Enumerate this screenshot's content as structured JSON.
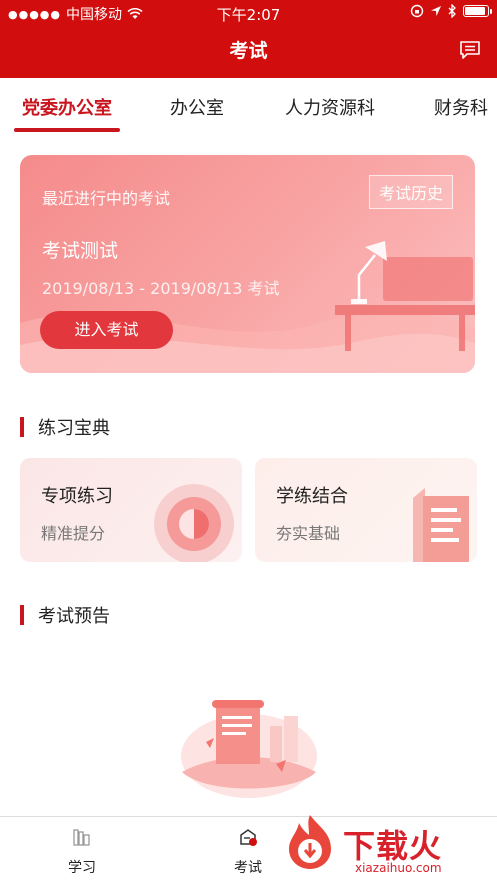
{
  "status_bar": {
    "carrier": "中国移动",
    "time": "下午2:07"
  },
  "nav": {
    "title": "考试",
    "icon": "message-icon"
  },
  "tabs": [
    {
      "label": "党委办公室",
      "active": true
    },
    {
      "label": "办公室",
      "active": false
    },
    {
      "label": "人力资源科",
      "active": false
    },
    {
      "label": "财务科",
      "active": false
    }
  ],
  "recent_exam": {
    "section_label": "最近进行中的考试",
    "history_button": "考试历史",
    "exam_name": "考试测试",
    "exam_date": "2019/08/13 - 2019/08/13 考试",
    "enter_button": "进入考试"
  },
  "practice": {
    "title": "练习宝典",
    "cards": [
      {
        "title": "专项练习",
        "subtitle": "精准提分",
        "icon": "target-icon"
      },
      {
        "title": "学练结合",
        "subtitle": "夯实基础",
        "icon": "document-icon"
      }
    ]
  },
  "forecast": {
    "title": "考试预告",
    "empty_icon": "scroll-illustration"
  },
  "bottom_tabs": [
    {
      "label": "学习",
      "icon": "books-icon",
      "active": false
    },
    {
      "label": "考试",
      "icon": "exam-icon",
      "active": true
    }
  ],
  "watermark": {
    "text": "下载火",
    "sub": "xiazaihuo.com"
  },
  "colors": {
    "brand_red": "#d20d0d",
    "accent_red": "#c9151e",
    "card_pink": "#f58b8b"
  }
}
